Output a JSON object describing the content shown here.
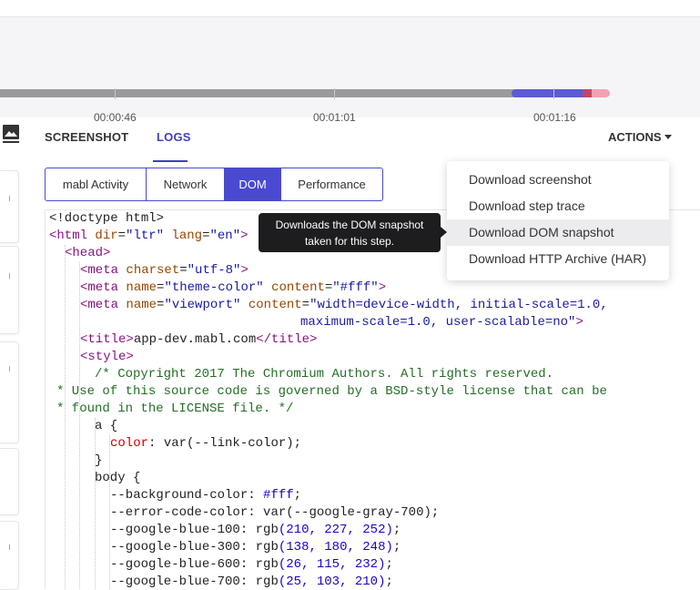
{
  "timeline": {
    "ticks": [
      "00:00:46",
      "00:01:01",
      "00:01:16"
    ]
  },
  "tabs": {
    "screenshot": "SCREENSHOT",
    "logs": "LOGS",
    "active": "LOGS"
  },
  "actions": {
    "label": "ACTIONS",
    "menu": [
      "Download screenshot",
      "Download step trace",
      "Download DOM snapshot",
      "Download HTTP Archive (HAR)"
    ],
    "highlighted": "Download DOM snapshot"
  },
  "tooltip": {
    "line1": "Downloads the DOM snapshot",
    "line2": "taken for this step."
  },
  "log_tabs": {
    "items": [
      "mabl Activity",
      "Network",
      "DOM",
      "Performance"
    ],
    "active": "DOM"
  },
  "colors": {
    "accent": "#4a4ad0",
    "timeline_active": "#5b5bd6",
    "timeline_marker": "#c2456b",
    "timeline_tail": "#f2a1b2"
  },
  "dom": {
    "doctype": "<!doctype html>",
    "html_open": {
      "tag": "<html",
      "a1": "dir",
      "v1": "\"ltr\"",
      "a2": "lang",
      "v2": "\"en\"",
      "close": ">"
    },
    "head_open": "<head>",
    "meta_charset": {
      "tag": "<meta",
      "a1": "charset",
      "v1": "\"utf-8\"",
      "close": ">"
    },
    "meta_theme": {
      "tag": "<meta",
      "a1": "name",
      "v1": "\"theme-color\"",
      "a2": "content",
      "v2": "\"#fff\"",
      "close": ">"
    },
    "meta_viewport": {
      "tag": "<meta",
      "a1": "name",
      "v1": "\"viewport\"",
      "a2": "content",
      "v2": "\"width=device-width, initial-scale=1.0,",
      "v2b": "maximum-scale=1.0, user-scalable=no\"",
      "close": ">"
    },
    "title": {
      "open": "<title>",
      "text": "app-dev.mabl.com",
      "close": "</title>"
    },
    "style_open": "<style>",
    "comment": [
      "/* Copyright 2017 The Chromium Authors. All rights reserved.",
      "* Use of this source code is governed by a BSD-style license that can be",
      "* found in the LICENSE file. */"
    ],
    "css_a_open": "a {",
    "css_a_prop": "color",
    "css_a_val": ": var(--link-color);",
    "close_brace": "}",
    "css_body_open": "body {",
    "vars": [
      {
        "name": "--background-color",
        "sep": ": ",
        "fn": "",
        "val": "#fff",
        "end": ";"
      },
      {
        "name": "--error-code-color",
        "sep": ": ",
        "fn": "var(--google-gray-700)",
        "val": "",
        "end": ";"
      },
      {
        "name": "--google-blue-100",
        "sep": ": ",
        "fn": "rgb",
        "val": "(210, 227, 252)",
        "end": ";"
      },
      {
        "name": "--google-blue-300",
        "sep": ": ",
        "fn": "rgb",
        "val": "(138, 180, 248)",
        "end": ";"
      },
      {
        "name": "--google-blue-600",
        "sep": ": ",
        "fn": "rgb",
        "val": "(26, 115, 232)",
        "end": ";"
      },
      {
        "name": "--google-blue-700",
        "sep": ": ",
        "fn": "rgb",
        "val": "(25, 103, 210)",
        "end": ";"
      }
    ]
  }
}
